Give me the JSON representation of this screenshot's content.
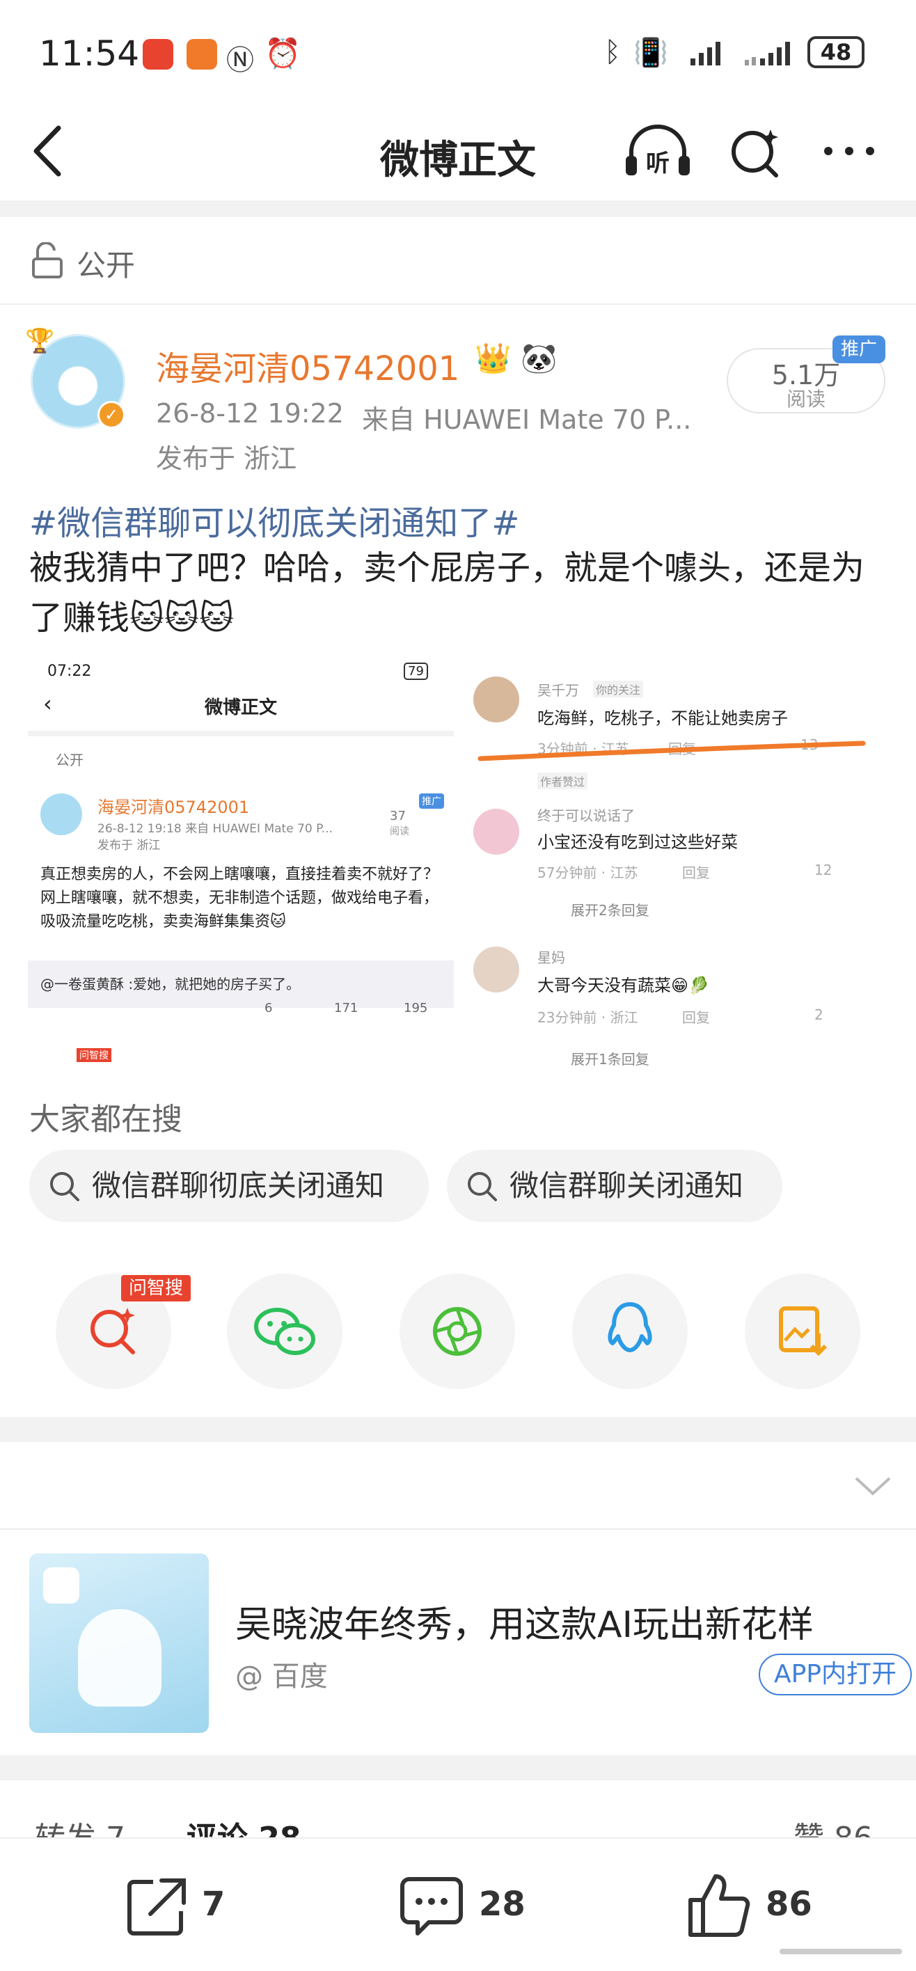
{
  "status": {
    "time": "11:54",
    "battery": "48"
  },
  "topbar": {
    "title": "微博正文"
  },
  "visibility": {
    "label": "公开"
  },
  "post": {
    "author": "海晏河清05742001",
    "meta_time": "26-8-12 19:22",
    "meta_source": "来自 HUAWEI Mate 70 P...",
    "location": "发布于 浙江",
    "reads_count": "5.1万",
    "reads_label": "阅读",
    "promo_badge": "推广",
    "hashtag": "#微信群聊可以彻底关闭通知了#",
    "body": "被我猜中了吧？哈哈，卖个屁房子，就是个噱头，还是为了赚钱🐱🐱🐱"
  },
  "embedded_screenshot": {
    "status_time": "07:22",
    "battery": "79",
    "title": "微博正文",
    "visibility": "公开",
    "author": "海晏河清05742001",
    "meta": "26-8-12 19:18  来自 HUAWEI Mate 70 P...",
    "location": "发布于 浙江",
    "reads_count": "37",
    "reads_label": "阅读",
    "promo_badge": "推广",
    "body": "真正想卖房的人，不会网上瞎嚷嚷，直接挂着卖不就好了？网上瞎嚷嚷，就不想卖，无非制造个话题，做戏给电子看，吸吸流量吃吃桃，卖卖海鲜集集资🐱",
    "quote": "@一卷蛋黄酥 :爱她，就把她的房子买了。",
    "counts": {
      "share": "6",
      "comment": "171",
      "like": "195"
    },
    "ask_badge": "问智搜",
    "comments": [
      {
        "user": "吴千万",
        "tag": "你的关注",
        "text": "吃海鲜，吃桃子，不能让她卖房子",
        "meta": "3分钟前 · 江苏",
        "reply": "回复",
        "likes": "13",
        "sub": "作者赞过"
      },
      {
        "user": "终于可以说话了",
        "tag": "",
        "text": "小宝还没有吃到过这些好菜",
        "meta": "57分钟前 · 江苏",
        "reply": "回复",
        "likes": "12",
        "expand": "展开2条回复"
      },
      {
        "user": "星妈",
        "tag": "",
        "text": "大哥今天没有蔬菜😁🥬",
        "meta": "23分钟前 · 浙江",
        "reply": "回复",
        "likes": "2",
        "expand": "展开1条回复"
      }
    ]
  },
  "search": {
    "heading": "大家都在搜",
    "chips": [
      "微信群聊彻底关闭通知",
      "微信群聊关闭通知"
    ]
  },
  "share": {
    "ask_badge": "问智搜"
  },
  "ad": {
    "title": "吴晓波年终秀，用这款AI玩出新花样",
    "source": "@ 百度",
    "button": "APP内打开"
  },
  "tabs": {
    "repost": "转发 7",
    "comment": "评论 28",
    "like": "赞 86"
  },
  "bottom": {
    "share_count": "7",
    "comment_count": "28",
    "like_count": "86"
  },
  "colors": {
    "author": "#e8772e",
    "hashtag": "#4a6b9c",
    "link": "#3f7fd8",
    "badge_blue": "#4a90e2",
    "badge_red": "#e8432e"
  }
}
